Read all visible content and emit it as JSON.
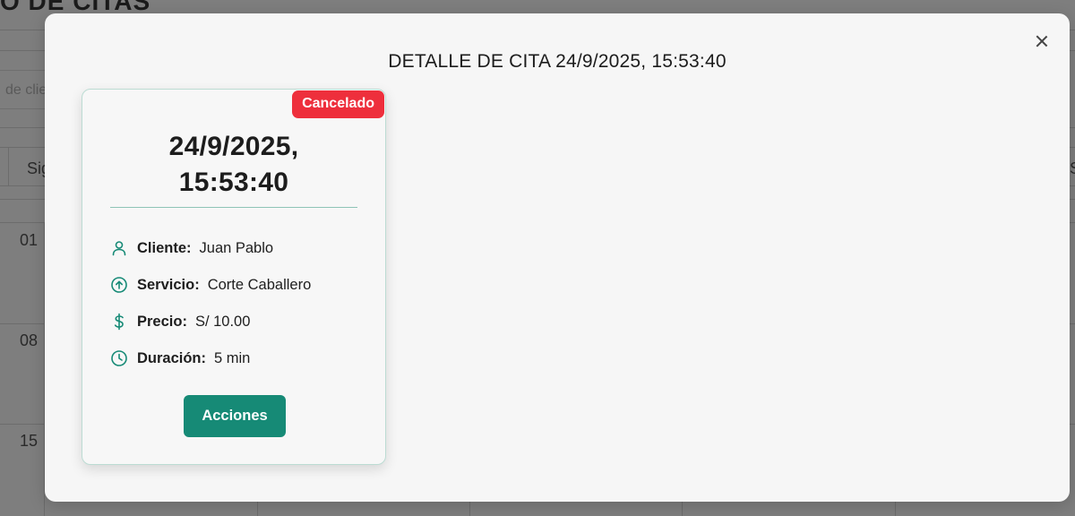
{
  "background": {
    "page_title": "O DE CITAS",
    "search_placeholder_fragment": "de clie",
    "table_header_fragment": "Sig",
    "table_header_right_fragment": "S",
    "days": [
      "01",
      "08",
      "15"
    ]
  },
  "modal": {
    "title": "DETALLE DE CITA 24/9/2025, 15:53:40",
    "close_icon": "close-icon"
  },
  "card": {
    "status": "Cancelado",
    "status_color": "#ee2f3c",
    "date_line1": "24/9/2025,",
    "date_line2": "15:53:40",
    "accent_color": "#168a76",
    "fields": {
      "client": {
        "icon": "user-icon",
        "label": "Cliente:",
        "value": "Juan Pablo"
      },
      "service": {
        "icon": "arrow-up-circle-icon",
        "label": "Servicio:",
        "value": "Corte Caballero"
      },
      "price": {
        "icon": "dollar-icon",
        "label": "Precio:",
        "value": "S/ 10.00"
      },
      "duration": {
        "icon": "clock-icon",
        "label": "Duración:",
        "value": "5 min"
      }
    },
    "actions_label": "Acciones"
  }
}
